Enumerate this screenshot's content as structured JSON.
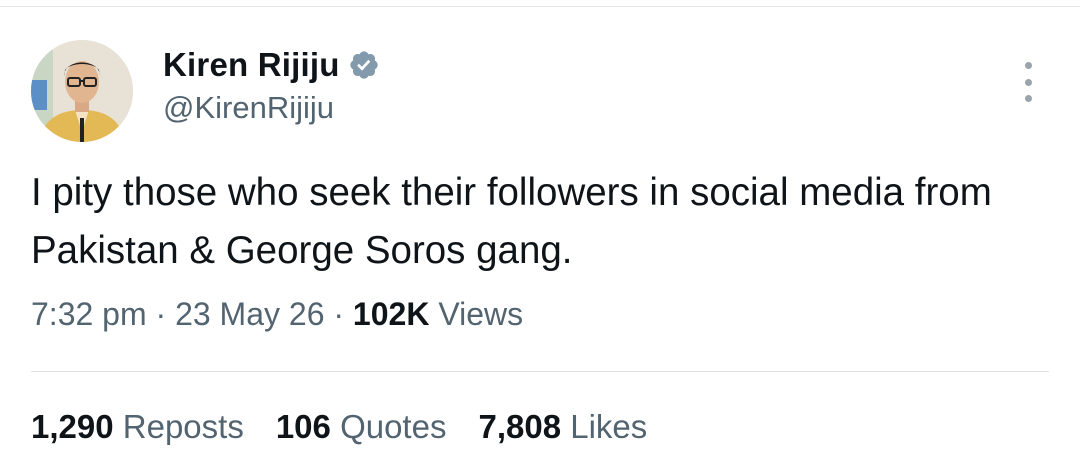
{
  "author": {
    "display_name": "Kiren Rijiju",
    "handle": "@KirenRijiju",
    "verified_icon": "verified-badge-icon",
    "verified_color": "#829aab"
  },
  "tweet": {
    "text": "I pity those who seek their followers in social media from Pakistan & George Soros gang."
  },
  "meta": {
    "time": "7:32 pm",
    "separator": "·",
    "date": "23 May 26",
    "views_count": "102K",
    "views_label": "Views"
  },
  "stats": [
    {
      "count": "1,290",
      "label": "Reposts"
    },
    {
      "count": "106",
      "label": "Quotes"
    },
    {
      "count": "7,808",
      "label": "Likes"
    }
  ],
  "menu": {
    "icon": "more-vertical-icon"
  },
  "colors": {
    "text_primary": "#0f1419",
    "text_secondary": "#536471",
    "divider": "#dfe3e6"
  }
}
